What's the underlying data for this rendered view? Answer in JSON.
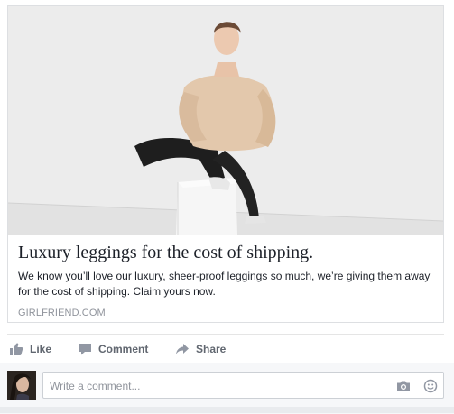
{
  "ad": {
    "headline": "Luxury leggings for the cost of shipping.",
    "description": "We know you’ll love our luxury, sheer-proof leggings so much, we’re giving them away for the cost of shipping. Claim yours now.",
    "domain": "GIRLFRIEND.COM"
  },
  "actions": {
    "like": "Like",
    "comment": "Comment",
    "share": "Share"
  },
  "comment_box": {
    "placeholder": "Write a comment..."
  },
  "icons": {
    "like": "thumbs-up-icon",
    "comment": "speech-bubble-icon",
    "share": "share-arrow-icon",
    "camera": "camera-icon",
    "emoji": "smiley-icon"
  },
  "colors": {
    "action_text": "#616770",
    "link_domain": "#90949c",
    "border": "#dddfe2"
  }
}
